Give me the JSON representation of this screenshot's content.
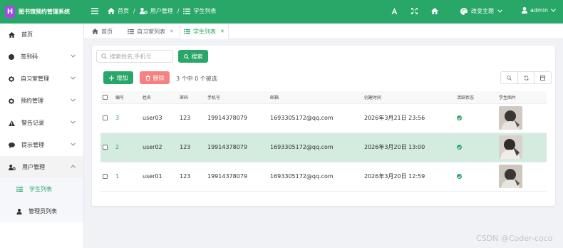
{
  "app": {
    "logo_letter": "H",
    "title": "图书馆预约管理系统"
  },
  "breadcrumb": [
    {
      "label": "首页"
    },
    {
      "label": "用户管理"
    },
    {
      "label": "学生列表"
    }
  ],
  "breadcrumb_sep": "/",
  "topbar": {
    "theme_label": "改变主题",
    "user_name": "admin"
  },
  "sidebar": {
    "items": [
      {
        "label": "首页",
        "icon": "home-icon"
      },
      {
        "label": "签到码",
        "icon": "circle-icon"
      },
      {
        "label": "自习室管理",
        "icon": "gear-icon"
      },
      {
        "label": "预约管理",
        "icon": "gear-icon"
      },
      {
        "label": "警告记录",
        "icon": "warning-icon"
      },
      {
        "label": "提示管理",
        "icon": "comment-icon"
      },
      {
        "label": "用户管理",
        "icon": "user-cog-icon"
      }
    ],
    "sub_items": [
      {
        "label": "学生列表",
        "icon": "list-icon",
        "active": true
      },
      {
        "label": "管理员列表",
        "icon": "user-icon",
        "active": false
      }
    ]
  },
  "tabs": [
    {
      "label": "首页",
      "closable": false
    },
    {
      "label": "自习室列表",
      "closable": true
    },
    {
      "label": "学生列表",
      "closable": true,
      "active": true
    }
  ],
  "toolbar": {
    "search_placeholder": "搜索姓名,手机号",
    "search_button": "搜索",
    "add_button": "增加",
    "delete_button": "删除",
    "selection_info": "3 个中 0 个被选"
  },
  "table": {
    "headers": [
      "编号",
      "姓名",
      "密码",
      "手机号",
      "邮箱",
      "创建时间",
      "活跃状态",
      "学生图片"
    ],
    "rows": [
      {
        "id": "3",
        "name": "user03",
        "password": "123",
        "phone": "19914378079",
        "email": "1693305172@qq.com",
        "created": "2026年3月21日 23:56",
        "active": true
      },
      {
        "id": "2",
        "name": "user02",
        "password": "123",
        "phone": "19914378079",
        "email": "1693305172@qq.com",
        "created": "2026年3月20日 13:00",
        "active": true
      },
      {
        "id": "1",
        "name": "user01",
        "password": "123",
        "phone": "19914378079",
        "email": "1693305172@qq.com",
        "created": "2026年3月20日 12:59",
        "active": true
      }
    ]
  },
  "watermark": "CSDN @Coder-coco",
  "colors": {
    "primary": "#29a769",
    "danger": "#f56c6c",
    "row_highlight": "#d4ebdf",
    "logo": "#a34be0"
  }
}
